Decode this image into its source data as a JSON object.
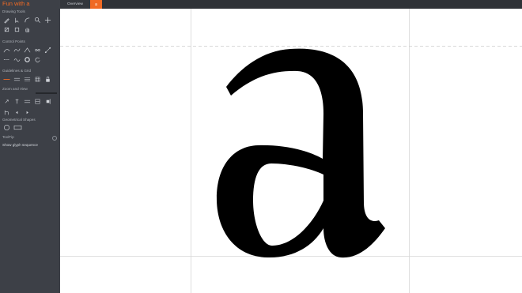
{
  "app": {
    "title": "Fun with a"
  },
  "tabs": [
    {
      "label": "Overview"
    },
    {
      "label": "a"
    }
  ],
  "sidebar": {
    "sections": [
      "Drawing Tools",
      "Control Points",
      "Guidelines & Grid",
      "Zoom and View",
      "Geometrical Shapes",
      "ToolTip"
    ],
    "tooltip_text": "Show glyph sequence"
  },
  "colors": {
    "accent": "#f06a24",
    "sidebar_bg": "#3d4047",
    "canvas_bg": "#ffffff",
    "glyph": "#000000"
  }
}
